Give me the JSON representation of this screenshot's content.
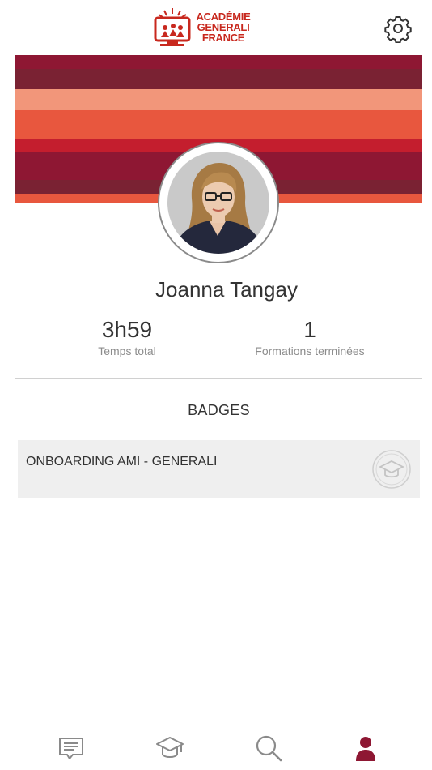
{
  "app": {
    "logo_lines": [
      "ACADÉMIE",
      "GENERALI",
      "FRANCE"
    ],
    "brand_color": "#c8281e"
  },
  "header": {
    "settings_icon": "gear-icon"
  },
  "banner": {
    "colors": [
      "#8e1733",
      "#7a2233",
      "#f2967a",
      "#e8573e",
      "#c41e2e",
      "#8e1733",
      "#7a2233",
      "#e8573e"
    ]
  },
  "profile": {
    "name": "Joanna Tangay",
    "stats": [
      {
        "value": "3h59",
        "label": "Temps total"
      },
      {
        "value": "1",
        "label": "Formations terminées"
      }
    ]
  },
  "badges": {
    "title": "BADGES",
    "items": [
      {
        "label": "ONBOARDING AMI - GENERALI",
        "icon": "graduation-cap-icon"
      }
    ]
  },
  "tabbar": {
    "items": [
      {
        "icon": "message-icon",
        "active": false
      },
      {
        "icon": "graduation-cap-icon",
        "active": false
      },
      {
        "icon": "search-icon",
        "active": false
      },
      {
        "icon": "user-icon",
        "active": true
      }
    ],
    "active_color": "#8e1733",
    "inactive_color": "#8a8a8a"
  }
}
